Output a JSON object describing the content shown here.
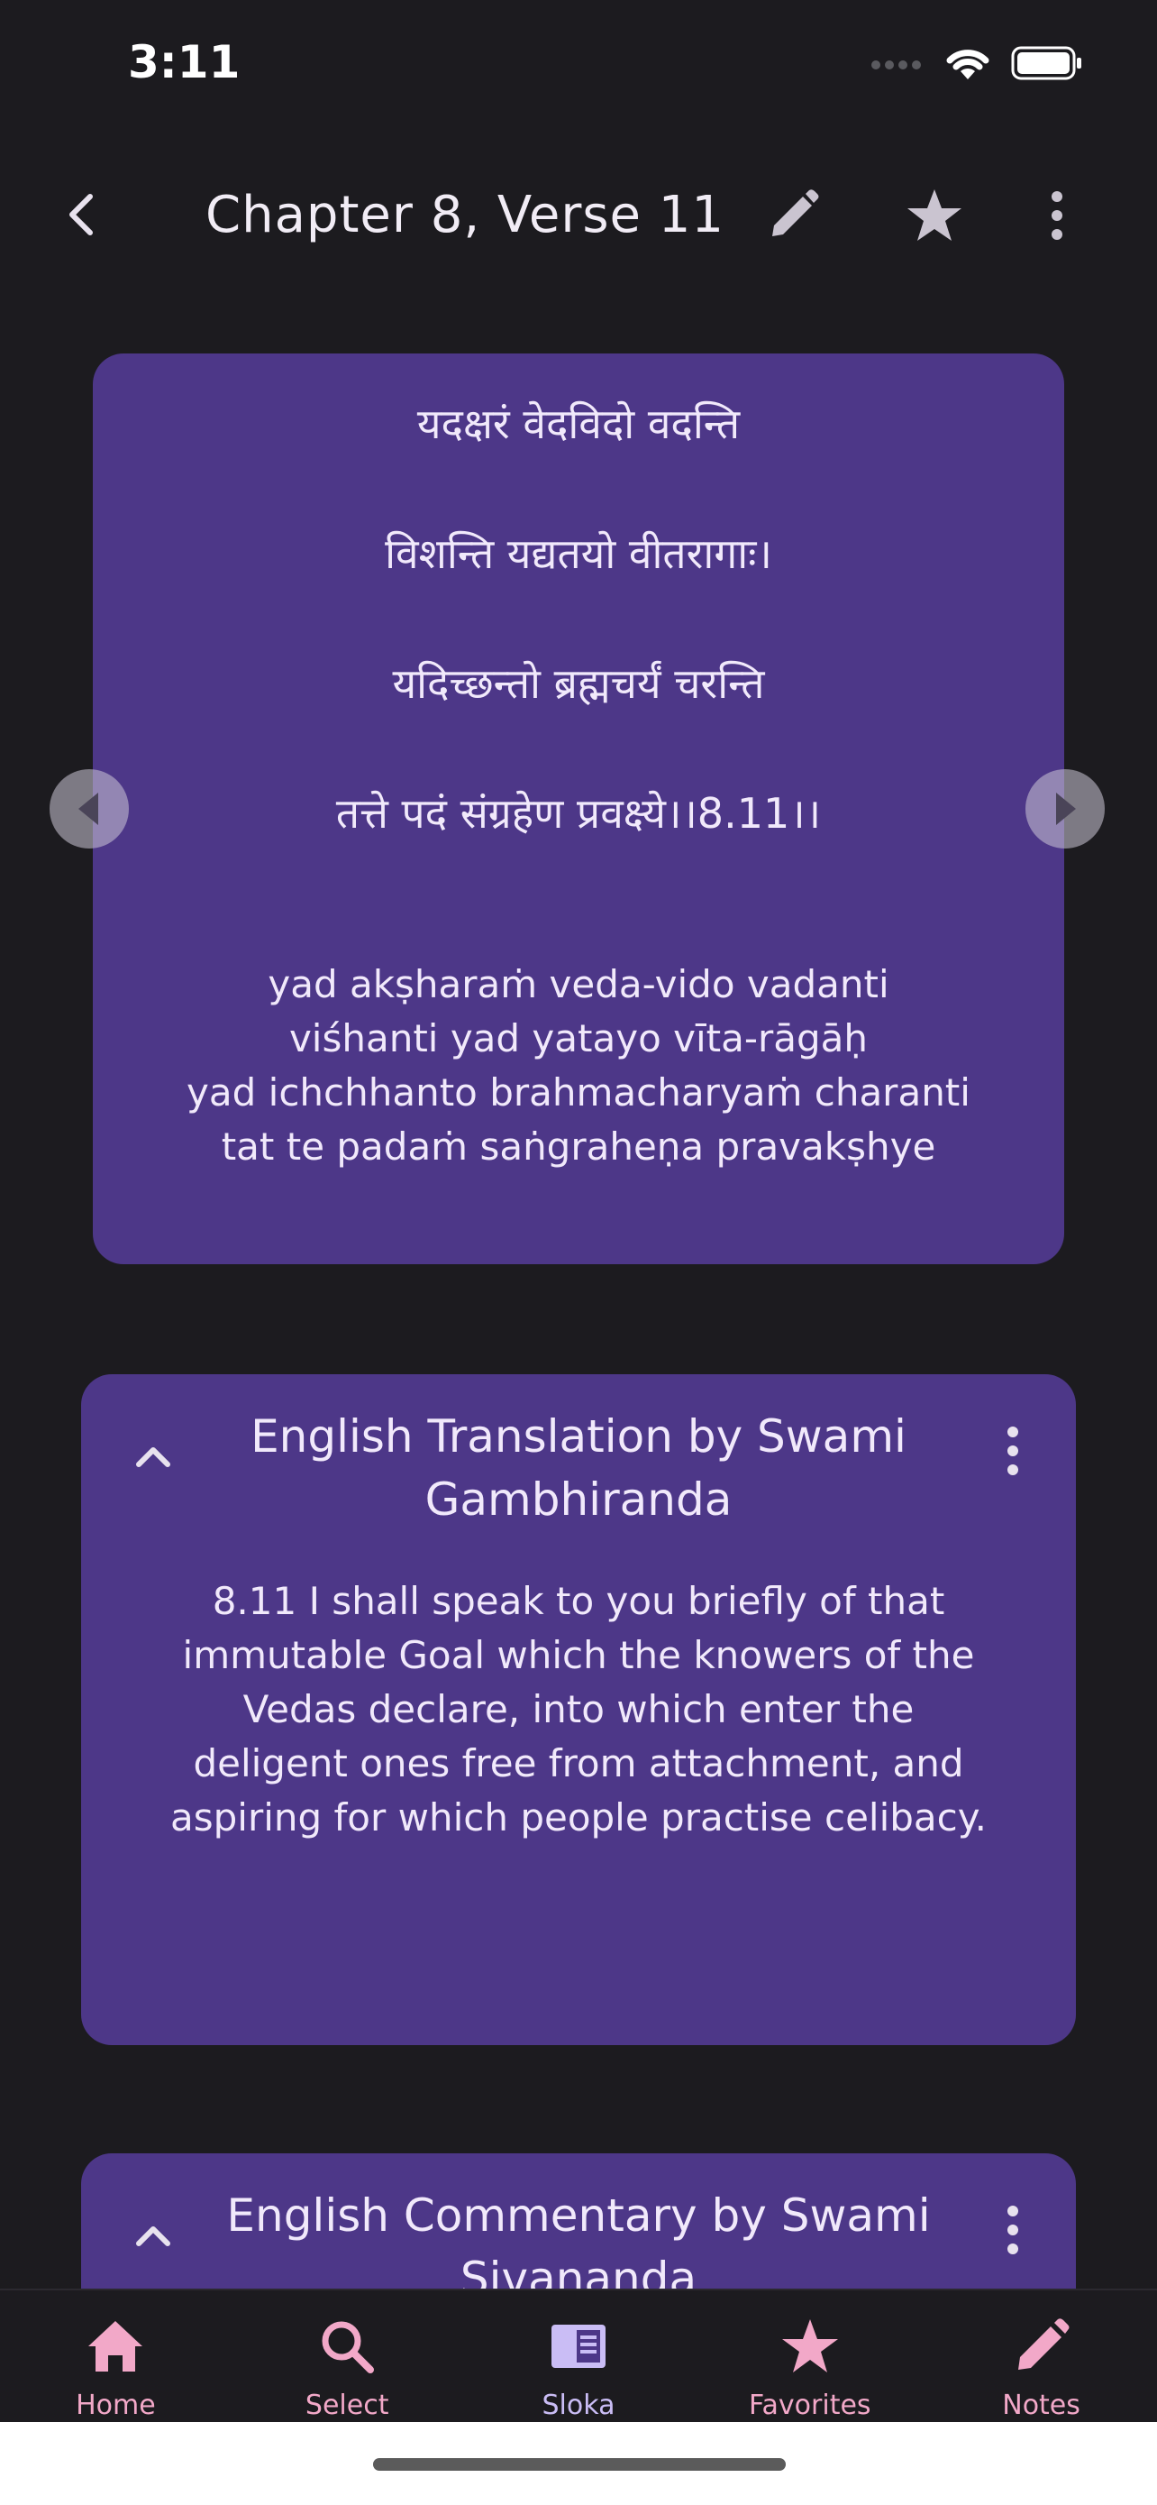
{
  "status_bar": {
    "time": "3:11"
  },
  "app_bar": {
    "title": "Chapter 8, Verse 11",
    "icons": [
      "back-arrow-icon",
      "pencil-icon",
      "star-icon",
      "more-vertical-icon"
    ]
  },
  "verse": {
    "sanskrit_lines": [
      "यदक्षरं वेदविदो वदन्ति",
      "विशन्ति यद्यतयो वीतरागाः।",
      "यदिच्छन्तो ब्रह्मचर्यं चरन्ति",
      "तत्ते पदं संग्रहेण प्रवक्ष्ये।।8.11।।"
    ],
    "transliteration_lines": [
      "yad akṣharaṁ veda-vido vadanti",
      "viśhanti yad yatayo vīta-rāgāḥ",
      "yad ichchhanto brahmacharyaṁ charanti",
      "tat te padaṁ saṅgraheṇa pravakṣhye"
    ]
  },
  "translation": {
    "title": "English Translation by Swami Gambhiranda",
    "body": "8.11 I shall speak to you briefly of that immutable Goal which the knowers of the Vedas declare, into which enter the deligent ones free from attachment, and aspiring for which people practise celibacy."
  },
  "commentary": {
    "title": "English Commentary by Swami Sivananda"
  },
  "bottom_nav": {
    "items": [
      {
        "label": "Home",
        "icon": "home-icon"
      },
      {
        "label": "Select",
        "icon": "search-icon"
      },
      {
        "label": "Sloka",
        "icon": "book-icon"
      },
      {
        "label": "Favorites",
        "icon": "star-icon"
      },
      {
        "label": "Notes",
        "icon": "pencil-icon"
      }
    ],
    "active": "Sloka"
  },
  "colors": {
    "background": "#1c1b1f",
    "card": "#4d3788",
    "nav_label": "#f2a8c8",
    "nav_active": "#cabdf5"
  }
}
